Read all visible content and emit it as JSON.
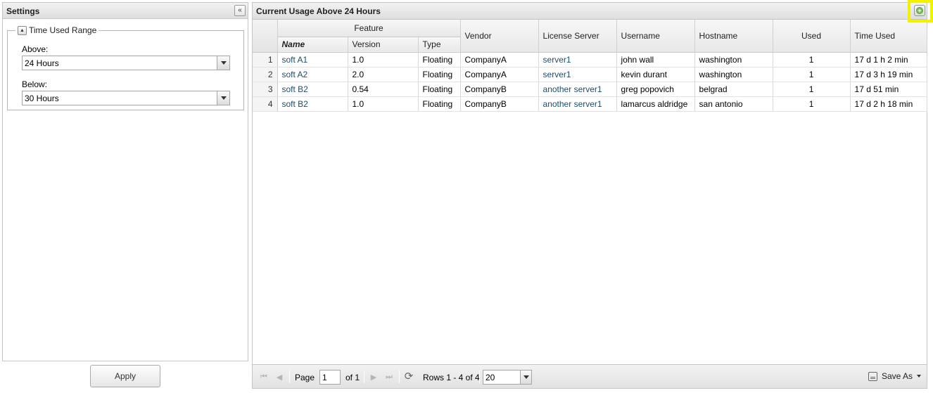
{
  "settings": {
    "title": "Settings",
    "fieldset_label": "Time Used Range",
    "above_label": "Above:",
    "above_value": "24 Hours",
    "below_label": "Below:",
    "below_value": "30 Hours",
    "apply_label": "Apply"
  },
  "grid": {
    "title": "Current Usage Above 24 Hours",
    "group_header": "Feature",
    "columns": {
      "name": "Name",
      "version": "Version",
      "type": "Type",
      "vendor": "Vendor",
      "license_server": "License Server",
      "username": "Username",
      "hostname": "Hostname",
      "used": "Used",
      "time_used": "Time Used"
    },
    "rows": [
      {
        "n": "1",
        "name": "soft A1",
        "version": "1.0",
        "type": "Floating",
        "vendor": "CompanyA",
        "license_server": "server1",
        "username": "john wall",
        "hostname": "washington",
        "used": "1",
        "time_used": "17 d 1 h 2 min"
      },
      {
        "n": "2",
        "name": "soft A2",
        "version": "2.0",
        "type": "Floating",
        "vendor": "CompanyA",
        "license_server": "server1",
        "username": "kevin durant",
        "hostname": "washington",
        "used": "1",
        "time_used": "17 d 3 h 19 min"
      },
      {
        "n": "3",
        "name": "soft B2",
        "version": "0.54",
        "type": "Floating",
        "vendor": "CompanyB",
        "license_server": "another server1",
        "username": "greg popovich",
        "hostname": "belgrad",
        "used": "1",
        "time_used": "17 d 51 min"
      },
      {
        "n": "4",
        "name": "soft B2",
        "version": "1.0",
        "type": "Floating",
        "vendor": "CompanyB",
        "license_server": "another server1",
        "username": "lamarcus aldridge",
        "hostname": "san antonio",
        "used": "1",
        "time_used": "17 d 2 h 18 min"
      }
    ]
  },
  "pager": {
    "page_label": "Page",
    "page_value": "1",
    "of_label": "of 1",
    "rows_info": "Rows 1 - 4 of 4",
    "rows_per_page": "20",
    "save_as_label": "Save As"
  }
}
